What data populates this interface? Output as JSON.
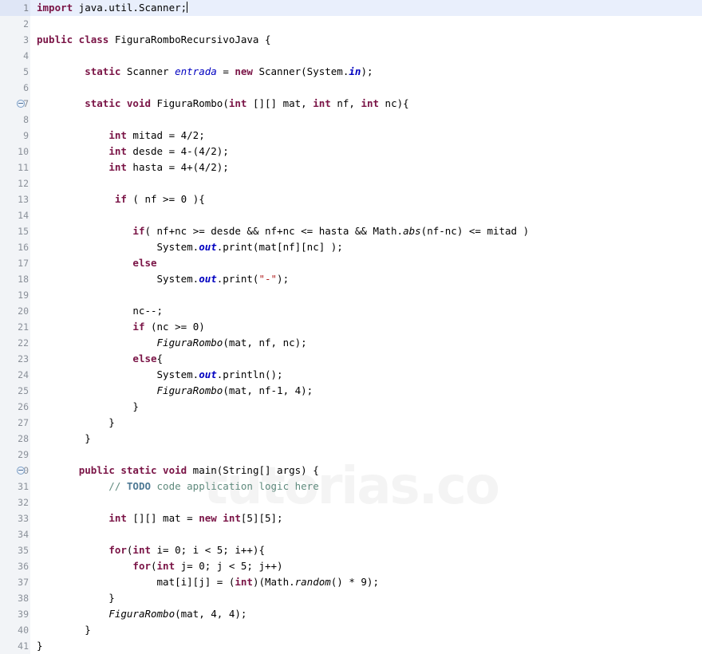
{
  "editor": {
    "file_name": "FiguraRomboRecursivoJava.java",
    "language": "java",
    "watermark": "tutorias.co",
    "current_line": 1,
    "total_lines": 41,
    "colors": {
      "background": "#ffffff",
      "gutter_background": "#f2f4f7",
      "gutter_text": "#8a9099",
      "current_line_highlight": "#e9effc",
      "keyword": "#7a1446",
      "field": "#0000c0",
      "string": "#b22222",
      "comment": "#5f8a7d",
      "comment_todo": "#4f7a95",
      "watermark": "#f4f4f4",
      "fold_icon": "#7b9ec6"
    },
    "fold_icon_name": "collapse-minus-icon",
    "fold_lines": [
      7,
      30
    ]
  },
  "lines": [
    {
      "n": "1",
      "fold": false,
      "current": true,
      "caret": true,
      "tokens": [
        {
          "t": "import",
          "c": "kw"
        },
        {
          "t": " java.util.Scanner;",
          "c": "plain"
        }
      ]
    },
    {
      "n": "2",
      "fold": false,
      "current": false,
      "caret": false,
      "tokens": []
    },
    {
      "n": "3",
      "fold": false,
      "current": false,
      "caret": false,
      "tokens": [
        {
          "t": "public class",
          "c": "kw"
        },
        {
          "t": " FiguraRomboRecursivoJava {",
          "c": "plain"
        }
      ]
    },
    {
      "n": "4",
      "fold": false,
      "current": false,
      "caret": false,
      "tokens": []
    },
    {
      "n": "5",
      "fold": false,
      "current": false,
      "caret": false,
      "tokens": [
        {
          "t": "        ",
          "c": "plain"
        },
        {
          "t": "static",
          "c": "kw"
        },
        {
          "t": " Scanner ",
          "c": "plain"
        },
        {
          "t": "entrada",
          "c": "var"
        },
        {
          "t": " = ",
          "c": "plain"
        },
        {
          "t": "new",
          "c": "kw"
        },
        {
          "t": " Scanner(System.",
          "c": "plain"
        },
        {
          "t": "in",
          "c": "stat"
        },
        {
          "t": ");",
          "c": "plain"
        }
      ]
    },
    {
      "n": "6",
      "fold": false,
      "current": false,
      "caret": false,
      "tokens": []
    },
    {
      "n": "7",
      "fold": true,
      "current": false,
      "caret": false,
      "tokens": [
        {
          "t": "        ",
          "c": "plain"
        },
        {
          "t": "static void",
          "c": "kw"
        },
        {
          "t": " FiguraRombo(",
          "c": "plain"
        },
        {
          "t": "int",
          "c": "kw"
        },
        {
          "t": " [][] mat, ",
          "c": "plain"
        },
        {
          "t": "int",
          "c": "kw"
        },
        {
          "t": " nf, ",
          "c": "plain"
        },
        {
          "t": "int",
          "c": "kw"
        },
        {
          "t": " nc){",
          "c": "plain"
        }
      ]
    },
    {
      "n": "8",
      "fold": false,
      "current": false,
      "caret": false,
      "tokens": []
    },
    {
      "n": "9",
      "fold": false,
      "current": false,
      "caret": false,
      "tokens": [
        {
          "t": "            ",
          "c": "plain"
        },
        {
          "t": "int",
          "c": "kw"
        },
        {
          "t": " mitad = 4/2;",
          "c": "plain"
        }
      ]
    },
    {
      "n": "10",
      "fold": false,
      "current": false,
      "caret": false,
      "tokens": [
        {
          "t": "            ",
          "c": "plain"
        },
        {
          "t": "int",
          "c": "kw"
        },
        {
          "t": " desde = 4-(4/2);",
          "c": "plain"
        }
      ]
    },
    {
      "n": "11",
      "fold": false,
      "current": false,
      "caret": false,
      "tokens": [
        {
          "t": "            ",
          "c": "plain"
        },
        {
          "t": "int",
          "c": "kw"
        },
        {
          "t": " hasta = 4+(4/2);",
          "c": "plain"
        }
      ]
    },
    {
      "n": "12",
      "fold": false,
      "current": false,
      "caret": false,
      "tokens": []
    },
    {
      "n": "13",
      "fold": false,
      "current": false,
      "caret": false,
      "tokens": [
        {
          "t": "             ",
          "c": "plain"
        },
        {
          "t": "if",
          "c": "kw"
        },
        {
          "t": " ( nf >= 0 ){",
          "c": "plain"
        }
      ]
    },
    {
      "n": "14",
      "fold": false,
      "current": false,
      "caret": false,
      "tokens": []
    },
    {
      "n": "15",
      "fold": false,
      "current": false,
      "caret": false,
      "tokens": [
        {
          "t": "                ",
          "c": "plain"
        },
        {
          "t": "if",
          "c": "kw"
        },
        {
          "t": "( nf+nc >= desde && nf+nc <= hasta && Math.",
          "c": "plain"
        },
        {
          "t": "abs",
          "c": "mth"
        },
        {
          "t": "(nf-nc) <= mitad )",
          "c": "plain"
        }
      ]
    },
    {
      "n": "16",
      "fold": false,
      "current": false,
      "caret": false,
      "tokens": [
        {
          "t": "                    System.",
          "c": "plain"
        },
        {
          "t": "out",
          "c": "stat"
        },
        {
          "t": ".print(mat[nf][nc] );",
          "c": "plain"
        }
      ]
    },
    {
      "n": "17",
      "fold": false,
      "current": false,
      "caret": false,
      "tokens": [
        {
          "t": "                ",
          "c": "plain"
        },
        {
          "t": "else",
          "c": "kw"
        }
      ]
    },
    {
      "n": "18",
      "fold": false,
      "current": false,
      "caret": false,
      "tokens": [
        {
          "t": "                    System.",
          "c": "plain"
        },
        {
          "t": "out",
          "c": "stat"
        },
        {
          "t": ".print(",
          "c": "plain"
        },
        {
          "t": "\"-\"",
          "c": "str"
        },
        {
          "t": ");",
          "c": "plain"
        }
      ]
    },
    {
      "n": "19",
      "fold": false,
      "current": false,
      "caret": false,
      "tokens": []
    },
    {
      "n": "20",
      "fold": false,
      "current": false,
      "caret": false,
      "tokens": [
        {
          "t": "                nc--;",
          "c": "plain"
        }
      ]
    },
    {
      "n": "21",
      "fold": false,
      "current": false,
      "caret": false,
      "tokens": [
        {
          "t": "                ",
          "c": "plain"
        },
        {
          "t": "if",
          "c": "kw"
        },
        {
          "t": " (nc >= 0)",
          "c": "plain"
        }
      ]
    },
    {
      "n": "22",
      "fold": false,
      "current": false,
      "caret": false,
      "tokens": [
        {
          "t": "                    ",
          "c": "plain"
        },
        {
          "t": "FiguraRombo",
          "c": "mth"
        },
        {
          "t": "(mat, nf, nc);",
          "c": "plain"
        }
      ]
    },
    {
      "n": "23",
      "fold": false,
      "current": false,
      "caret": false,
      "tokens": [
        {
          "t": "                ",
          "c": "plain"
        },
        {
          "t": "else",
          "c": "kw"
        },
        {
          "t": "{",
          "c": "plain"
        }
      ]
    },
    {
      "n": "24",
      "fold": false,
      "current": false,
      "caret": false,
      "tokens": [
        {
          "t": "                    System.",
          "c": "plain"
        },
        {
          "t": "out",
          "c": "stat"
        },
        {
          "t": ".println();",
          "c": "plain"
        }
      ]
    },
    {
      "n": "25",
      "fold": false,
      "current": false,
      "caret": false,
      "tokens": [
        {
          "t": "                    ",
          "c": "plain"
        },
        {
          "t": "FiguraRombo",
          "c": "mth"
        },
        {
          "t": "(mat, nf-1, 4);",
          "c": "plain"
        }
      ]
    },
    {
      "n": "26",
      "fold": false,
      "current": false,
      "caret": false,
      "tokens": [
        {
          "t": "                }",
          "c": "plain"
        }
      ]
    },
    {
      "n": "27",
      "fold": false,
      "current": false,
      "caret": false,
      "tokens": [
        {
          "t": "            }",
          "c": "plain"
        }
      ]
    },
    {
      "n": "28",
      "fold": false,
      "current": false,
      "caret": false,
      "tokens": [
        {
          "t": "        }",
          "c": "plain"
        }
      ]
    },
    {
      "n": "29",
      "fold": false,
      "current": false,
      "caret": false,
      "tokens": []
    },
    {
      "n": "30",
      "fold": true,
      "current": false,
      "caret": false,
      "tokens": [
        {
          "t": "       ",
          "c": "plain"
        },
        {
          "t": "public static void",
          "c": "kw"
        },
        {
          "t": " main(String[] args) {",
          "c": "plain"
        }
      ]
    },
    {
      "n": "31",
      "fold": false,
      "current": false,
      "caret": false,
      "comment": "            // TODO code application logic here",
      "tokens": []
    },
    {
      "n": "32",
      "fold": false,
      "current": false,
      "caret": false,
      "tokens": []
    },
    {
      "n": "33",
      "fold": false,
      "current": false,
      "caret": false,
      "tokens": [
        {
          "t": "            ",
          "c": "plain"
        },
        {
          "t": "int",
          "c": "kw"
        },
        {
          "t": " [][] mat = ",
          "c": "plain"
        },
        {
          "t": "new int",
          "c": "kw"
        },
        {
          "t": "[5][5];",
          "c": "plain"
        }
      ]
    },
    {
      "n": "34",
      "fold": false,
      "current": false,
      "caret": false,
      "tokens": []
    },
    {
      "n": "35",
      "fold": false,
      "current": false,
      "caret": false,
      "tokens": [
        {
          "t": "            ",
          "c": "plain"
        },
        {
          "t": "for",
          "c": "kw"
        },
        {
          "t": "(",
          "c": "plain"
        },
        {
          "t": "int",
          "c": "kw"
        },
        {
          "t": " i= 0; i < 5; i++){",
          "c": "plain"
        }
      ]
    },
    {
      "n": "36",
      "fold": false,
      "current": false,
      "caret": false,
      "tokens": [
        {
          "t": "                ",
          "c": "plain"
        },
        {
          "t": "for",
          "c": "kw"
        },
        {
          "t": "(",
          "c": "plain"
        },
        {
          "t": "int",
          "c": "kw"
        },
        {
          "t": " j= 0; j < 5; j++)",
          "c": "plain"
        }
      ]
    },
    {
      "n": "37",
      "fold": false,
      "current": false,
      "caret": false,
      "tokens": [
        {
          "t": "                    mat[i][j] = (",
          "c": "plain"
        },
        {
          "t": "int",
          "c": "kw"
        },
        {
          "t": ")(Math.",
          "c": "plain"
        },
        {
          "t": "random",
          "c": "mth"
        },
        {
          "t": "() * 9);",
          "c": "plain"
        }
      ]
    },
    {
      "n": "38",
      "fold": false,
      "current": false,
      "caret": false,
      "tokens": [
        {
          "t": "            }",
          "c": "plain"
        }
      ]
    },
    {
      "n": "39",
      "fold": false,
      "current": false,
      "caret": false,
      "tokens": [
        {
          "t": "            ",
          "c": "plain"
        },
        {
          "t": "FiguraRombo",
          "c": "mth"
        },
        {
          "t": "(mat, 4, 4);",
          "c": "plain"
        }
      ]
    },
    {
      "n": "40",
      "fold": false,
      "current": false,
      "caret": false,
      "tokens": [
        {
          "t": "        }",
          "c": "plain"
        }
      ]
    },
    {
      "n": "41",
      "fold": false,
      "current": false,
      "caret": false,
      "tokens": [
        {
          "t": "}",
          "c": "plain"
        }
      ]
    }
  ]
}
